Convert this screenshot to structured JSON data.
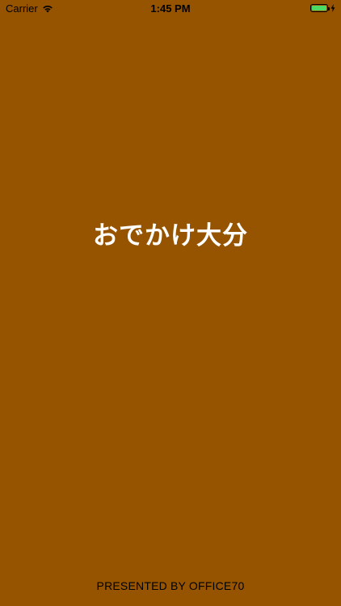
{
  "status_bar": {
    "carrier": "Carrier",
    "time": "1:45 PM",
    "wifi_icon": "wifi-icon",
    "battery_icon": "battery-icon",
    "charging_icon": "charging-bolt-icon",
    "battery_level": 1.0,
    "battery_color": "#4cd964"
  },
  "splash": {
    "background_color": "#965400",
    "title": "おでかけ大分",
    "credit": "PRESENTED BY OFFICE70"
  }
}
